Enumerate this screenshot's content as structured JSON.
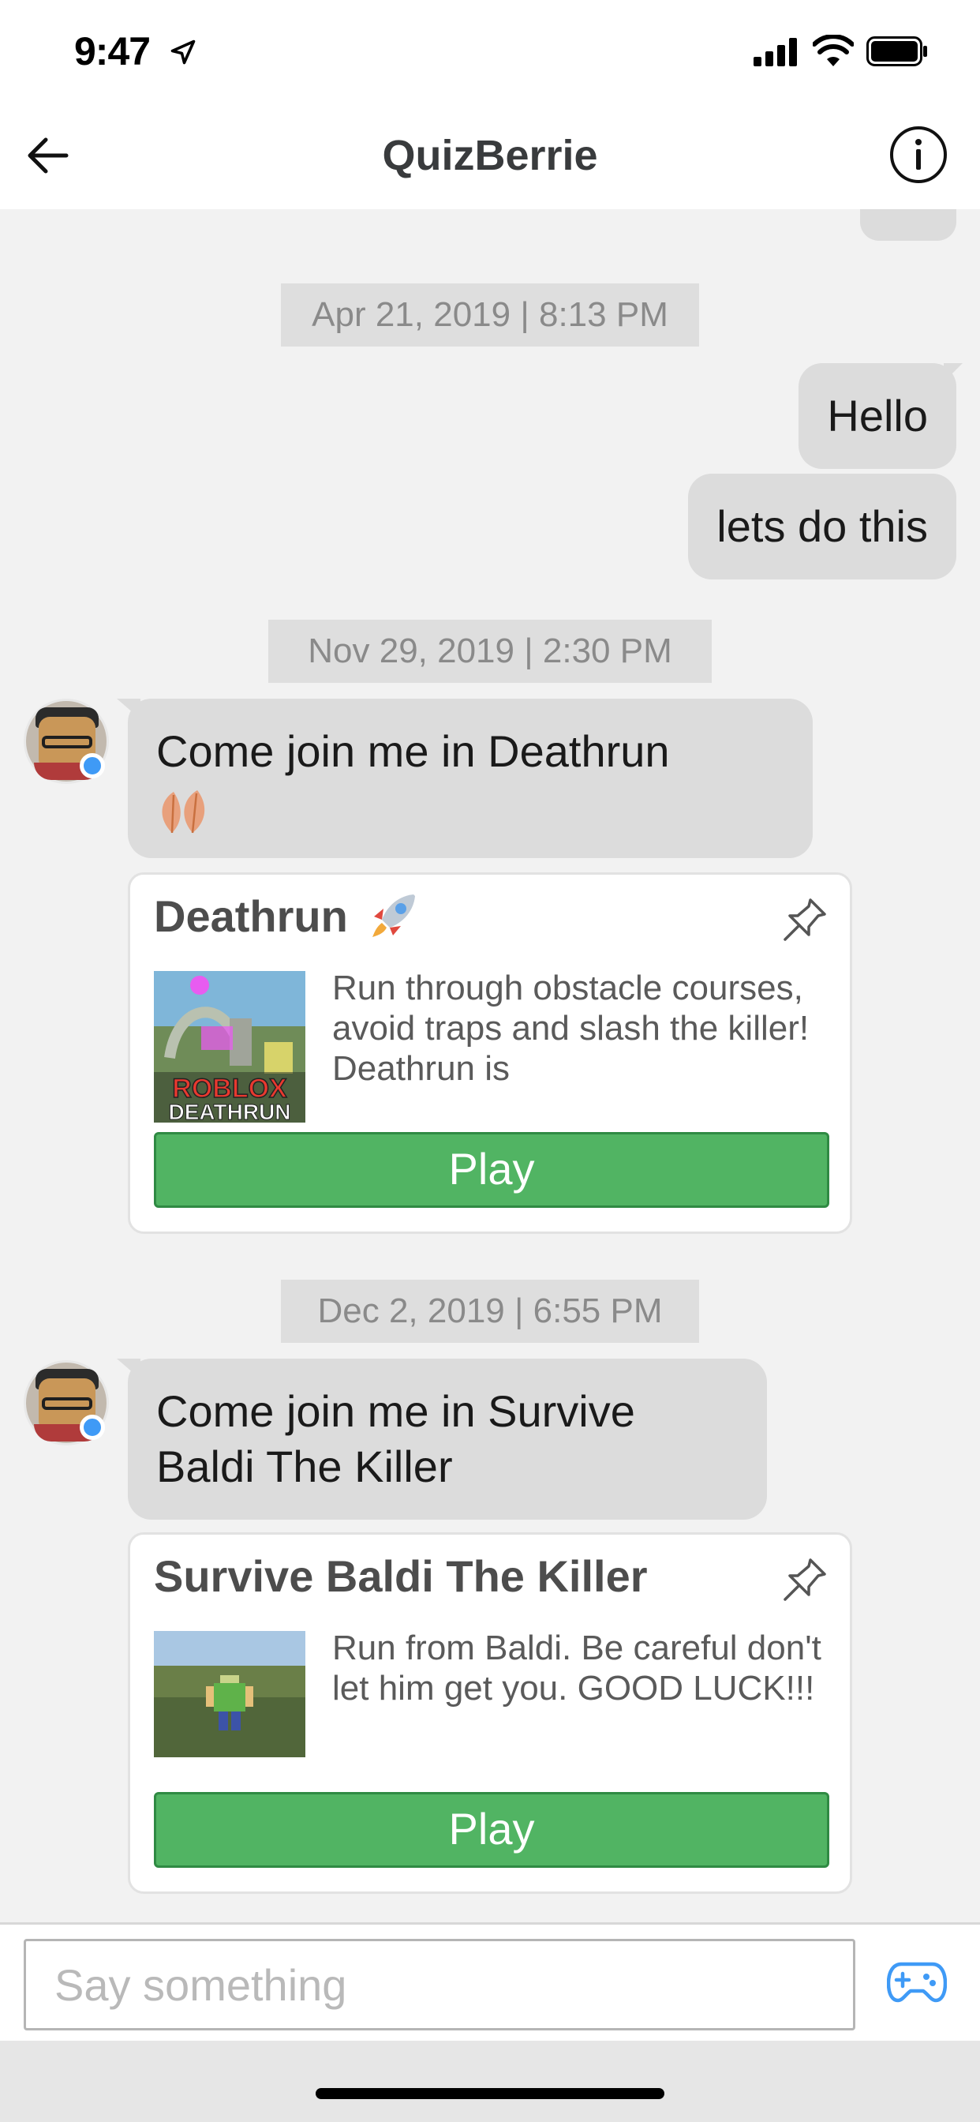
{
  "status_bar": {
    "time": "9:47"
  },
  "header": {
    "title": "QuizBerrie"
  },
  "colors": {
    "accent_blue": "#3f9af6",
    "play_green": "#51b463",
    "bubble_gray": "#dcdcdc"
  },
  "messages": {
    "date_1": "Apr 21, 2019 | 8:13 PM",
    "out_1": "Hello",
    "out_2": "lets do this",
    "date_2": "Nov 29, 2019 | 2:30 PM",
    "in_1": "Come join me in Deathrun",
    "date_3": "Dec 2, 2019 | 6:55 PM",
    "in_2_line1": "Come join me in Survive",
    "in_2_line2": "Baldi The Killer"
  },
  "cards": [
    {
      "title": "Deathrun",
      "description": "Run through obstacle courses, avoid traps and slash the killer! Deathrun is",
      "thumb_text_1": "ROBLOX",
      "thumb_text_2": "DEATHRUN",
      "play_label": "Play"
    },
    {
      "title": "Survive Baldi The Killer",
      "description": "Run from Baldi. Be careful don't let him get you. GOOD LUCK!!!",
      "play_label": "Play"
    }
  ],
  "composer": {
    "placeholder": "Say something"
  },
  "icons": [
    "location-arrow-icon",
    "signal-icon",
    "wifi-icon",
    "battery-icon",
    "back-arrow-icon",
    "info-icon",
    "leaves-emoji-icon",
    "rocket-emoji-icon",
    "pin-icon",
    "gamepad-icon"
  ]
}
